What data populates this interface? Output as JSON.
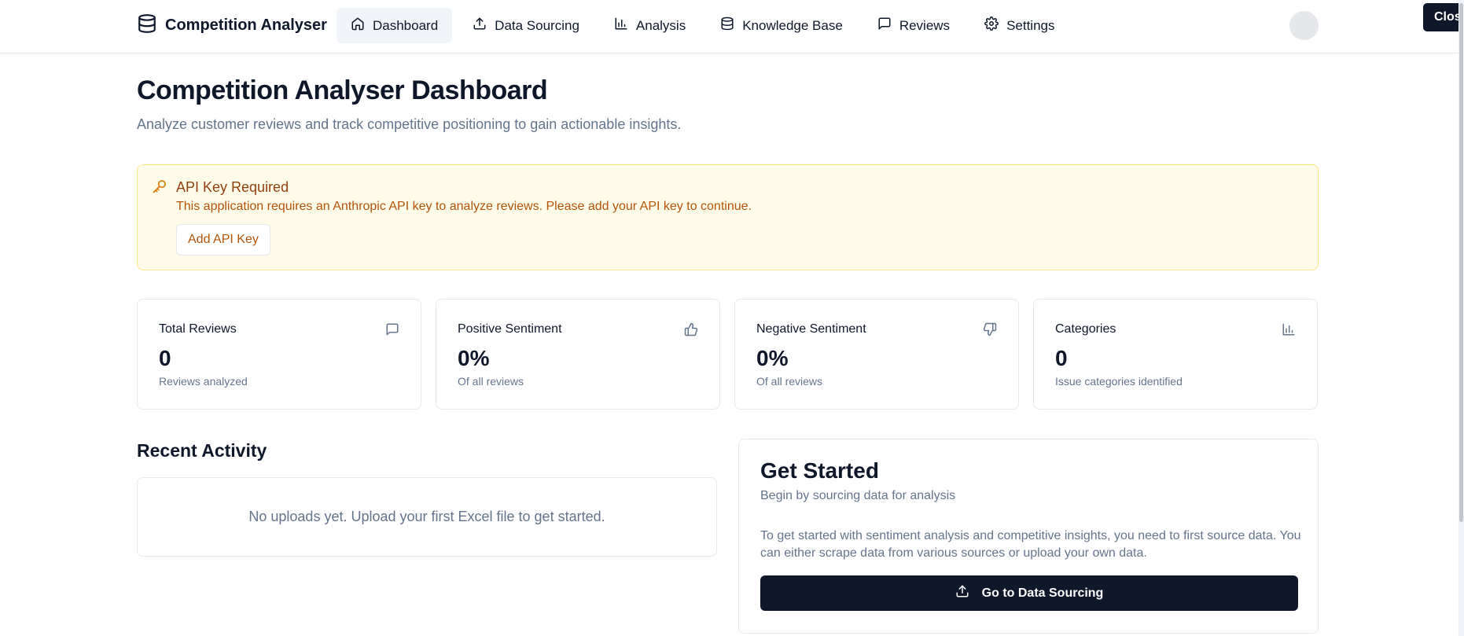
{
  "app": {
    "name": "Competition Analyser"
  },
  "nav": {
    "items": [
      {
        "label": "Dashboard",
        "icon": "home-icon",
        "active": true
      },
      {
        "label": "Data Sourcing",
        "icon": "upload-icon"
      },
      {
        "label": "Analysis",
        "icon": "bar-chart-icon"
      },
      {
        "label": "Knowledge Base",
        "icon": "database-icon"
      },
      {
        "label": "Reviews",
        "icon": "message-square-icon"
      },
      {
        "label": "Settings",
        "icon": "gear-icon"
      }
    ]
  },
  "tooltip": {
    "close_label": "Close"
  },
  "header": {
    "title": "Competition Analyser Dashboard",
    "subtitle": "Analyze customer reviews and track competitive positioning to gain actionable insights."
  },
  "alert": {
    "title": "API Key Required",
    "text": "This application requires an Anthropic API key to analyze reviews. Please add your API key to continue.",
    "button_label": "Add API Key"
  },
  "stats": [
    {
      "title": "Total Reviews",
      "value": "0",
      "caption": "Reviews analyzed",
      "icon": "message-square-icon"
    },
    {
      "title": "Positive Sentiment",
      "value": "0%",
      "caption": "Of all reviews",
      "icon": "thumbs-up-icon"
    },
    {
      "title": "Negative Sentiment",
      "value": "0%",
      "caption": "Of all reviews",
      "icon": "thumbs-down-icon"
    },
    {
      "title": "Categories",
      "value": "0",
      "caption": "Issue categories identified",
      "icon": "bar-chart-icon"
    }
  ],
  "recent_activity": {
    "title": "Recent Activity",
    "empty_text": "No uploads yet. Upload your first Excel file to get started."
  },
  "get_started": {
    "title": "Get Started",
    "subtitle": "Begin by sourcing data for analysis",
    "body": "To get started with sentiment analysis and competitive insights, you need to first source data. You can either scrape data from various sources or upload your own data.",
    "button_label": "Go to Data Sourcing"
  },
  "colors": {
    "primary": "#0f172a",
    "muted_text": "#64748b",
    "alert_bg": "#fefce8",
    "alert_border": "#fde68a",
    "alert_title": "#92400e",
    "alert_text": "#b45309"
  }
}
